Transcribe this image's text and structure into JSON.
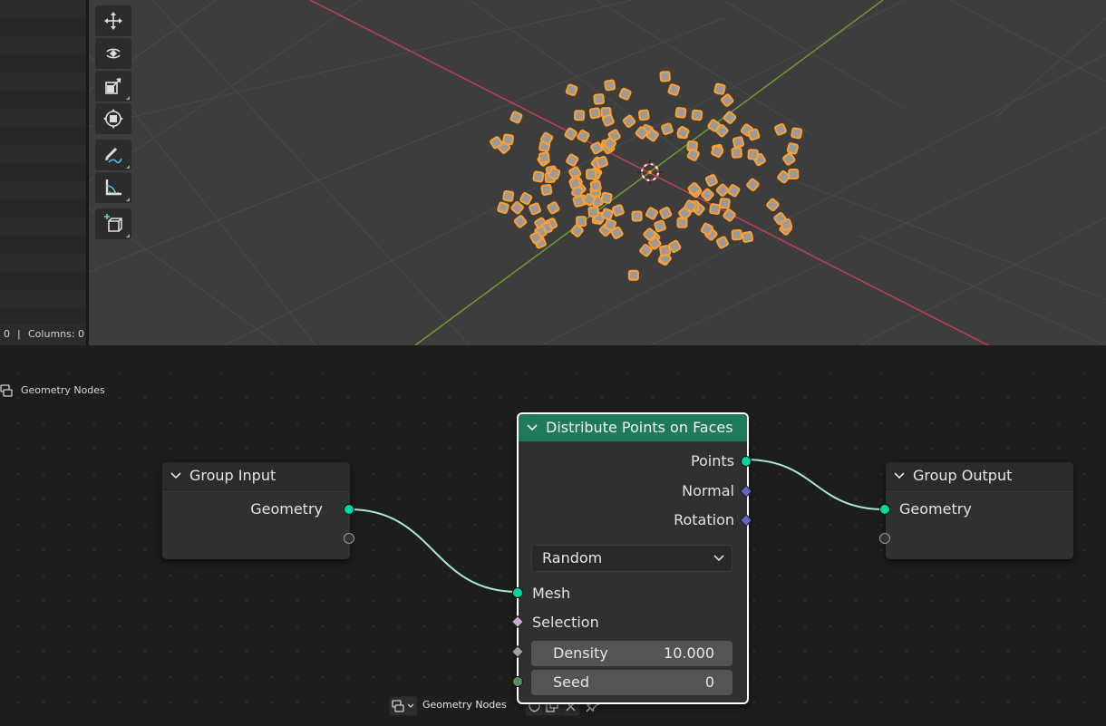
{
  "spreadsheet": {
    "rows_label": "0",
    "separator": "|",
    "columns_label": "Columns: 0"
  },
  "viewport": {
    "tools": [
      "move-icon",
      "rotate-icon",
      "scale-icon",
      "transform-icon",
      "annotate-icon",
      "measure-icon",
      "add-cube-icon"
    ],
    "axis_colors": {
      "x": "#c0404e",
      "y": "#6f9a2e"
    },
    "selection_color": "#ff9f2e"
  },
  "node_editor": {
    "header": {
      "editor_type_icon": "node-tree-icon",
      "tree_name": "Geometry Nodes",
      "fake_user_icon": "shield-icon",
      "duplicate_icon": "duplicate-icon",
      "unlink_icon": "close-icon",
      "pin_icon": "pin-icon"
    },
    "breadcrumb": "Geometry Nodes",
    "nodes": {
      "group_input": {
        "title": "Group Input",
        "outputs": [
          "Geometry"
        ]
      },
      "distribute": {
        "title": "Distribute Points on Faces",
        "outputs": [
          "Points",
          "Normal",
          "Rotation"
        ],
        "mode": "Random",
        "inputs": {
          "mesh": "Mesh",
          "selection": "Selection",
          "density_label": "Density",
          "density_value": "10.000",
          "seed_label": "Seed",
          "seed_value": "0"
        }
      },
      "group_output": {
        "title": "Group Output",
        "inputs": [
          "Geometry"
        ]
      }
    },
    "colors": {
      "geometry_socket": "#00d6a3",
      "vector_socket": "#6363c7",
      "link": "#a8e8d2",
      "distribute_header": "#1e7a5a"
    }
  }
}
